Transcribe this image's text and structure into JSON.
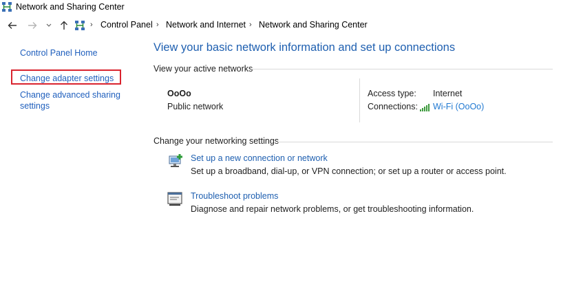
{
  "window": {
    "title": "Network and Sharing Center"
  },
  "breadcrumb": [
    "Control Panel",
    "Network and Internet",
    "Network and Sharing Center"
  ],
  "sidebar": {
    "home": "Control Panel Home",
    "adapter": "Change adapter settings",
    "advanced": "Change advanced sharing settings"
  },
  "main": {
    "heading": "View your basic network information and set up connections",
    "active_networks_title": "View your active networks",
    "network": {
      "name": "OoOo",
      "type": "Public network",
      "access_type_label": "Access type:",
      "access_type_value": "Internet",
      "connections_label": "Connections:",
      "connection_name": "Wi-Fi (OoOo)"
    },
    "settings_title": "Change your networking settings",
    "tasks": [
      {
        "title": "Set up a new connection or network",
        "description": "Set up a broadband, dial-up, or VPN connection; or set up a router or access point."
      },
      {
        "title": "Troubleshoot problems",
        "description": "Diagnose and repair network problems, or get troubleshooting information."
      }
    ]
  },
  "colors": {
    "link": "#1e5fb0",
    "highlight": "#d9232e",
    "heading": "#1e5fb0"
  }
}
